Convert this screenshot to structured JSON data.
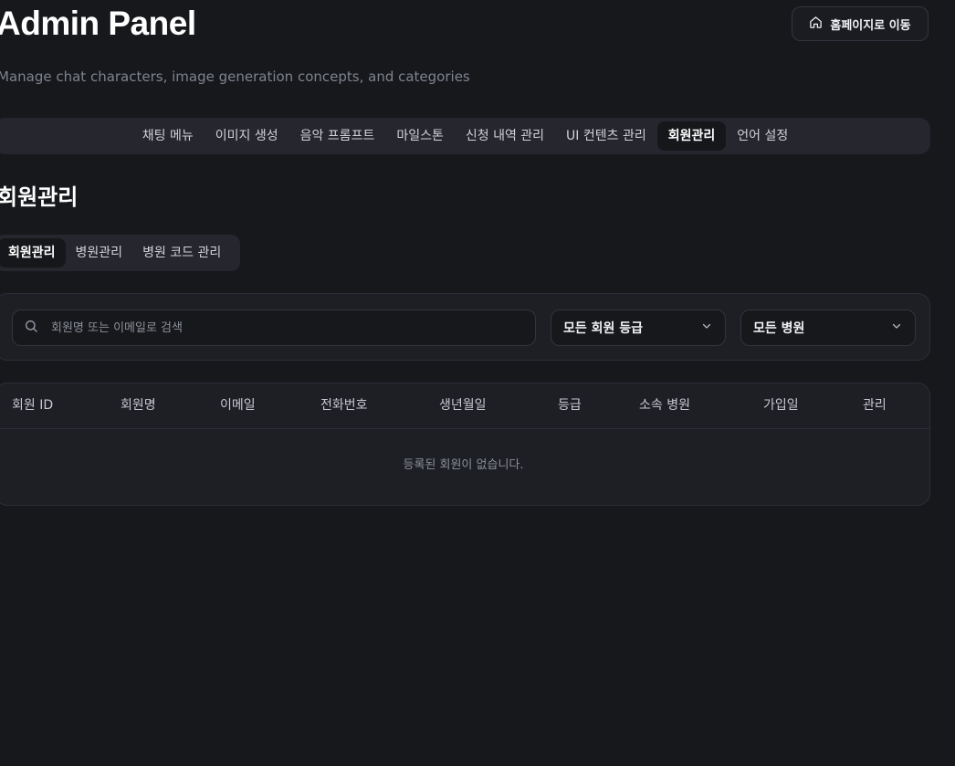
{
  "header": {
    "title": "Admin Panel",
    "subtitle": "Manage chat characters, image generation concepts, and categories",
    "home_button": {
      "label": "홈페이지로 이동",
      "icon": "home-icon"
    }
  },
  "nav": {
    "items": [
      {
        "label": "채팅 메뉴",
        "active": false
      },
      {
        "label": "이미지 생성",
        "active": false
      },
      {
        "label": "음악 프롬프트",
        "active": false
      },
      {
        "label": "마일스톤",
        "active": false
      },
      {
        "label": "신청 내역 관리",
        "active": false
      },
      {
        "label": "UI 컨텐츠 관리",
        "active": false
      },
      {
        "label": "회원관리",
        "active": true
      },
      {
        "label": "언어 설정",
        "active": false
      }
    ]
  },
  "section": {
    "title": "회원관리",
    "subtabs": [
      {
        "label": "회원관리",
        "active": true
      },
      {
        "label": "병원관리",
        "active": false
      },
      {
        "label": "병원 코드 관리",
        "active": false
      }
    ]
  },
  "filters": {
    "search": {
      "placeholder": "회원명 또는 이메일로 검색",
      "value": "",
      "icon": "search-icon"
    },
    "grade_select": {
      "value": "모든 회원 등급",
      "icon": "chevron-down-icon"
    },
    "hospital_select": {
      "value": "모든 병원",
      "icon": "chevron-down-icon"
    }
  },
  "table": {
    "columns": [
      "회원 ID",
      "회원명",
      "이메일",
      "전화번호",
      "생년월일",
      "등급",
      "소속 병원",
      "가입일",
      "관리"
    ],
    "rows": [],
    "empty_message": "등록된 회원이 없습니다."
  },
  "colors": {
    "background": "#17181c",
    "card": "#1e1f25",
    "nav_bg": "#25262e",
    "active_tab": "#16171b",
    "muted_text": "#8b8f99"
  }
}
